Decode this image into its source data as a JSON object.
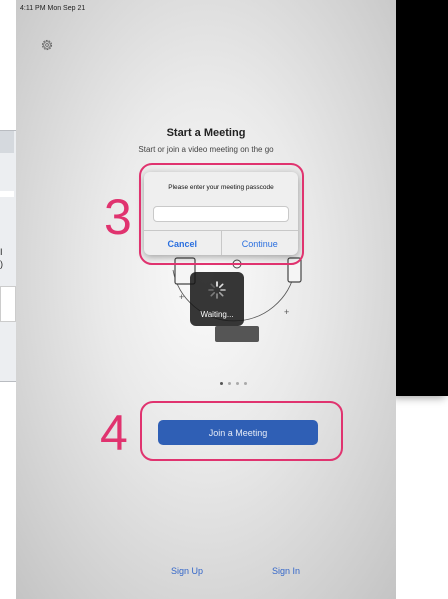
{
  "status_bar": {
    "time_date": "4:11 PM  Mon Sep 21"
  },
  "main": {
    "title": "Start a Meeting",
    "subtitle": "Start or join a video meeting on the go"
  },
  "dialog": {
    "prompt": "Please enter your meeting passcode",
    "input_value": "",
    "cancel_label": "Cancel",
    "continue_label": "Continue"
  },
  "waiting": {
    "label": "Waiting..."
  },
  "join_button": {
    "label": "Join a Meeting"
  },
  "footer": {
    "sign_up": "Sign Up",
    "sign_in": "Sign In"
  },
  "annotations": {
    "step3": "3",
    "step4": "4"
  },
  "background_card": {
    "lines": [
      "I",
      ")"
    ]
  },
  "page_dots": {
    "count": 4,
    "active_index": 0
  },
  "colors": {
    "annotation": "#e0336f",
    "accent_blue": "#2a6fdf",
    "join_button": "#2f5fb5"
  }
}
